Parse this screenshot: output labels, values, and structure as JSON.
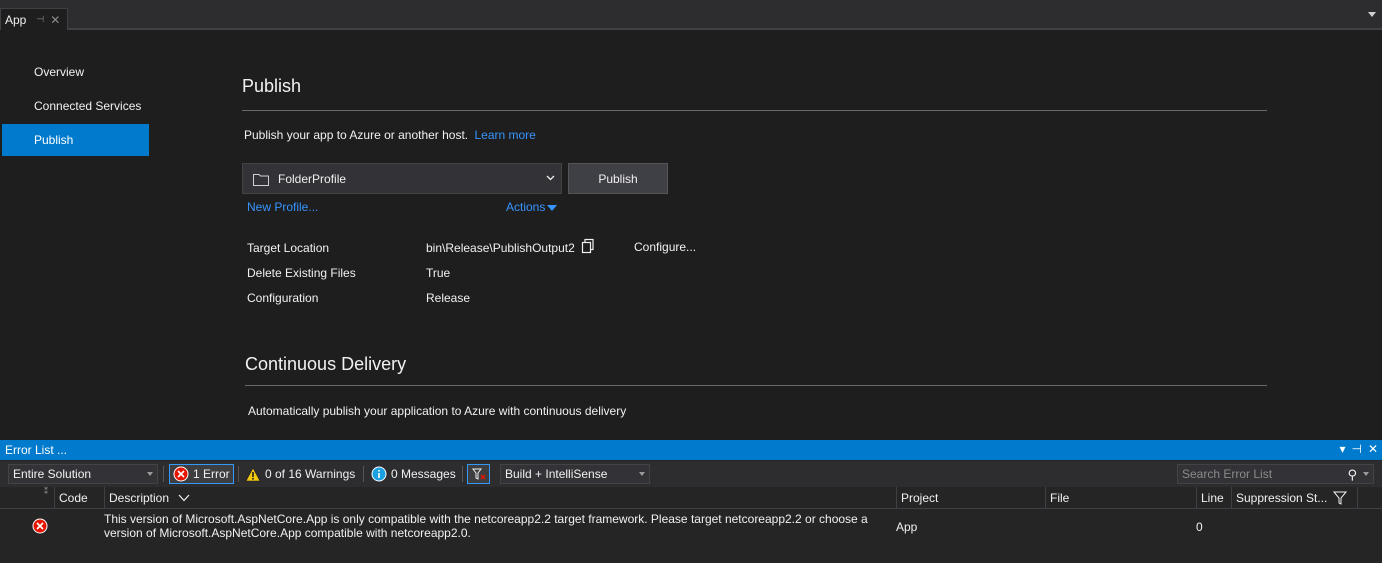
{
  "tab": {
    "title": "App",
    "pin": "⊣",
    "close": "✕"
  },
  "nav": {
    "items": [
      {
        "label": "Overview"
      },
      {
        "label": "Connected Services"
      },
      {
        "label": "Publish"
      }
    ]
  },
  "publish": {
    "heading": "Publish",
    "intro": "Publish your app to Azure or another host.",
    "learn_more": "Learn more",
    "profile_value": "FolderProfile",
    "publish_button": "Publish",
    "new_profile": "New Profile...",
    "actions": "Actions",
    "properties": [
      {
        "name": "Target Location",
        "value": "bin\\Release\\PublishOutput2"
      },
      {
        "name": "Delete Existing Files",
        "value": "True"
      },
      {
        "name": "Configuration",
        "value": "Release"
      }
    ],
    "configure": "Configure..."
  },
  "cd": {
    "heading": "Continuous Delivery",
    "text": "Automatically publish your application to Azure with continuous delivery"
  },
  "errorlist": {
    "title": "Error List ...",
    "scope": "Entire Solution",
    "errors": "1 Error",
    "warnings": "0 of 16 Warnings",
    "messages": "0 Messages",
    "build_filter": "Build + IntelliSense",
    "search_placeholder": "Search Error List",
    "columns": [
      "Code",
      "Description",
      "Project",
      "File",
      "Line",
      "Suppression St..."
    ],
    "rows": [
      {
        "description": "This version of Microsoft.AspNetCore.App is only compatible with the netcoreapp2.2 target framework. Please target netcoreapp2.2 or choose a version of Microsoft.AspNetCore.App compatible with netcoreapp2.0.",
        "project": "App",
        "line": "0"
      }
    ]
  },
  "colors": {
    "accent": "#007acc",
    "link": "#3794ff",
    "error": "#e51400",
    "warning": "#f2c811",
    "info": "#1ba1e2"
  }
}
